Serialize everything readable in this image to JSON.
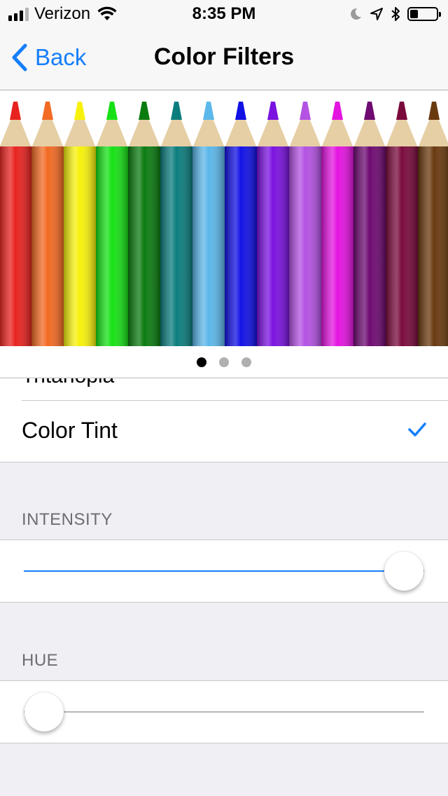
{
  "status_bar": {
    "carrier": "Verizon",
    "time": "8:35 PM",
    "signal_bars": 3,
    "battery_level": 0.3
  },
  "nav": {
    "back_label": "Back",
    "title": "Color Filters"
  },
  "pencil_colors": [
    "#e8231f",
    "#f26a24",
    "#f7f10c",
    "#17e116",
    "#0b7c10",
    "#0c7d7d",
    "#5cb7ea",
    "#1111e6",
    "#7b12e0",
    "#b452e3",
    "#e414e0",
    "#6e0a72",
    "#7a0a3c",
    "#6a3a0f"
  ],
  "pager": {
    "pages": 3,
    "current": 1
  },
  "filters": {
    "clipped_item": "Tritanopia",
    "selected_item": "Color Tint"
  },
  "intensity": {
    "header": "INTENSITY",
    "value": 0.95
  },
  "hue": {
    "header": "HUE",
    "value": 0.05
  },
  "colors": {
    "accent": "#157efb",
    "background": "#efeff4"
  }
}
